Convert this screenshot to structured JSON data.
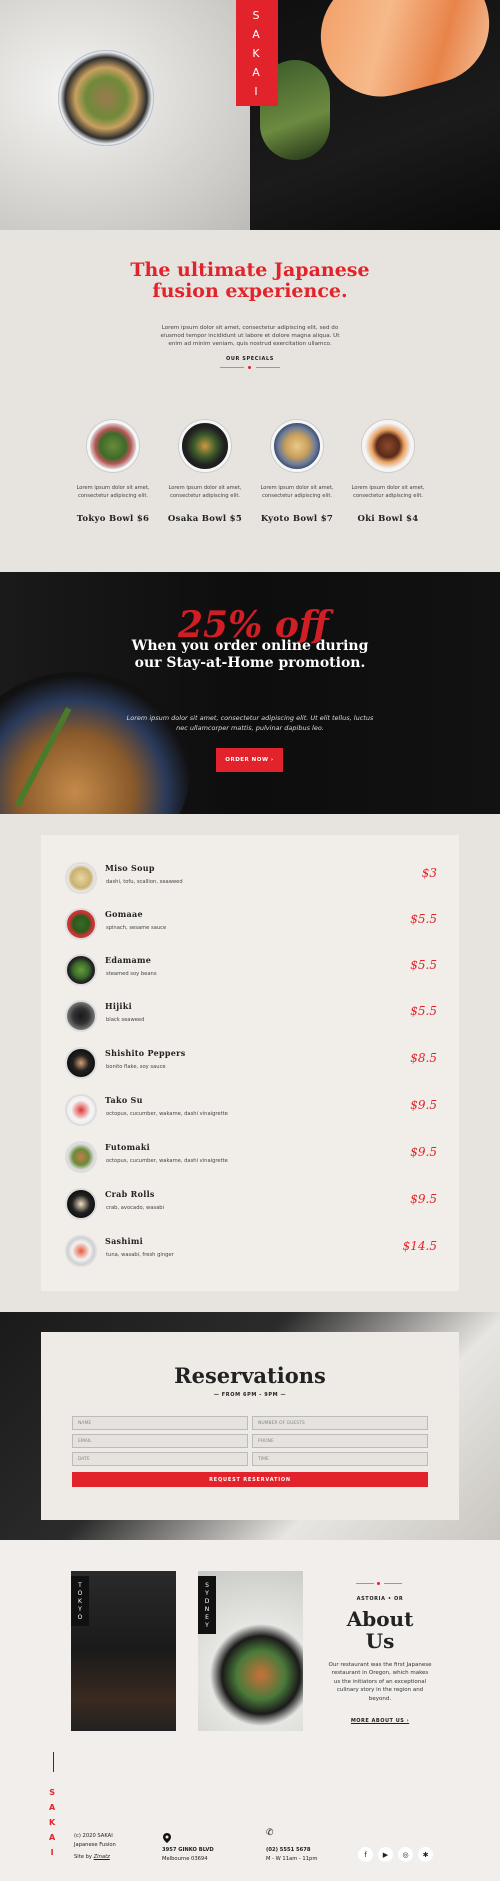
{
  "brand": {
    "logo_letters": [
      "S",
      "A",
      "K",
      "A",
      "I"
    ]
  },
  "intro": {
    "title": "The ultimate Japanese fusion experience.",
    "lead": "Lorem ipsum dolor sit amet, consectetur adipiscing elit, sed do eiusmod tempor incididunt ut labore et dolore magna aliqua. Ut enim ad minim veniam, quis nostrud exercitation ullamco.",
    "specials_label": "OUR SPECIALS"
  },
  "specials": [
    {
      "desc": "Lorem ipsum dolor sit amet, consectetur adipiscing elit.",
      "name": "Tokyo Bowl $6"
    },
    {
      "desc": "Lorem ipsum dolor sit amet, consectetur adipiscing elit.",
      "name": "Osaka Bowl $5"
    },
    {
      "desc": "Lorem ipsum dolor sit amet, consectetur adipiscing elit.",
      "name": "Kyoto Bowl $7"
    },
    {
      "desc": "Lorem ipsum dolor sit amet, consectetur adipiscing elit.",
      "name": "Oki Bowl $4"
    }
  ],
  "promo": {
    "big": "25% off",
    "title": "When you order online during our Stay-at-Home promotion.",
    "text": "Lorem ipsum dolor sit amet, consectetur adipiscing elit. Ut elit tellus, luctus nec ullamcorper mattis, pulvinar dapibus leo.",
    "button": "ORDER NOW ›"
  },
  "menu": [
    {
      "name": "Miso Soup",
      "desc": "dashi, tofu, scallion, seaweed",
      "price": "$3"
    },
    {
      "name": "Gomaae",
      "desc": "spinach, sesame sauce",
      "price": "$5.5"
    },
    {
      "name": "Edamame",
      "desc": "steamed soy beans",
      "price": "$5.5"
    },
    {
      "name": "Hijiki",
      "desc": "black seaweed",
      "price": "$5.5"
    },
    {
      "name": "Shishito Peppers",
      "desc": "bonito flake, soy sauce",
      "price": "$8.5"
    },
    {
      "name": "Tako Su",
      "desc": "octopus, cucumber, wakame, dashi vinaigrette",
      "price": "$9.5"
    },
    {
      "name": "Futomaki",
      "desc": "octopus, cucumber, wakame, dashi vinaigrette",
      "price": "$9.5"
    },
    {
      "name": "Crab Rolls",
      "desc": "crab, avocado, wasabi",
      "price": "$9.5"
    },
    {
      "name": "Sashimi",
      "desc": "tuna, wasabi, fresh ginger",
      "price": "$14.5"
    }
  ],
  "reservations": {
    "title": "Reservations",
    "hours": "— FROM 6PM - 9PM —",
    "fields": {
      "name": "NAME",
      "guests": "NUMBER OF GUESTS",
      "email": "EMAIL",
      "phone": "PHONE",
      "date": "DATE",
      "time": "TIME"
    },
    "button": "REQUEST RESERVATION"
  },
  "about": {
    "tag1": [
      "T",
      "O",
      "K",
      "Y",
      "O"
    ],
    "tag2": [
      "S",
      "Y",
      "D",
      "N",
      "E",
      "Y"
    ],
    "locations": "ASTORIA • OR",
    "title": "About Us",
    "text": "Our restaurant  was the first Japanese restaurant in Oregon, which makes us the initiators of an exceptional culinary story in the region and beyond.",
    "more": "MORE ABOUT US ›"
  },
  "footer": {
    "copyright": "(c) 2020 SAKAI",
    "copyright2": "Japanese Fusion",
    "site_by_prefix": "Site by ",
    "site_by_link": "Zinatz",
    "address1": "3957 GINKO BLVD",
    "address2": "Melbourne 03694",
    "phone": "(02) 5551 5678",
    "hours": "M - W 11am - 11pm"
  },
  "colors": {
    "accent": "#e3232b",
    "dark": "#111111",
    "cream": "#e7e3de"
  }
}
